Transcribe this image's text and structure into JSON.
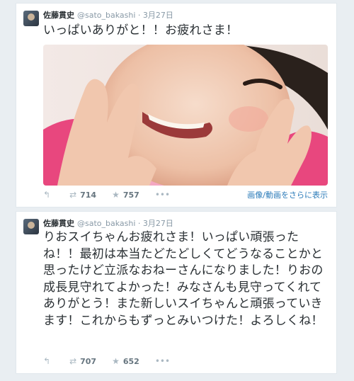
{
  "tweets": [
    {
      "name": "佐藤貫史",
      "handle": "@sato_bakashi",
      "date": "3月27日",
      "text": "いっぱいありがと！！お疲れさま！",
      "actions": {
        "reply_icon": "reply-icon",
        "retweet_icon": "retweet-icon",
        "retweets": "714",
        "favorite_icon": "star-icon",
        "favorites": "757",
        "more_icon": "more-icon"
      },
      "media_link": "画像/動画をさらに表示"
    },
    {
      "name": "佐藤貫史",
      "handle": "@sato_bakashi",
      "date": "3月27日",
      "text": "りおスイちゃんお疲れさま！いっぱい頑張ったね！！最初は本当たどたどしくてどうなることかと思ったけど立派なおねーさんになりました！りおの成長見守れてよかった！みなさんも見守ってくれてありがとう！また新しいスイちゃんと頑張っていきます！これからもずっとみいつけた！よろしくね！",
      "actions": {
        "reply_icon": "reply-icon",
        "retweet_icon": "retweet-icon",
        "retweets": "707",
        "favorite_icon": "star-icon",
        "favorites": "652",
        "more_icon": "more-icon"
      }
    }
  ],
  "colors": {
    "background": "#e9eef2",
    "text": "#292f33",
    "meta": "#8899a6",
    "link": "#2b7bb9"
  }
}
